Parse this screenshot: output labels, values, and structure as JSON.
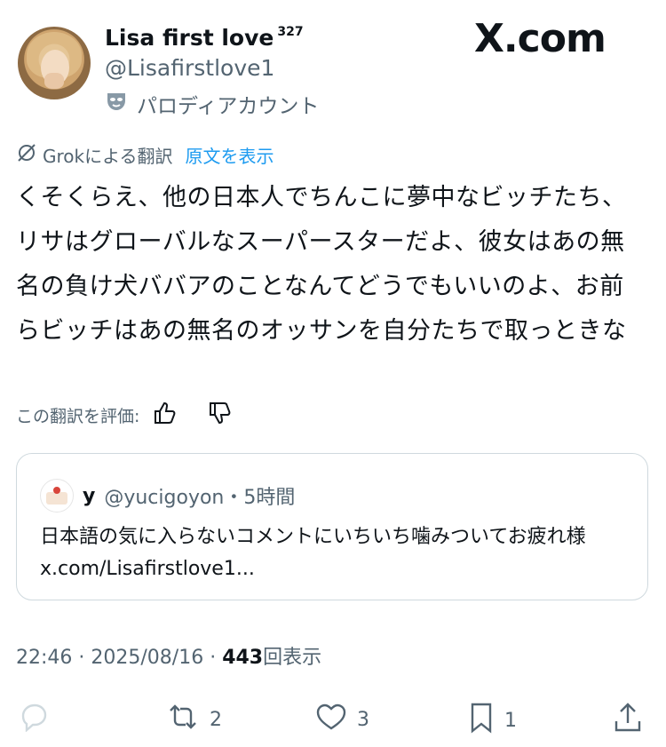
{
  "profile": {
    "display_name": "Lisa first love",
    "name_sup": "327",
    "handle": "@Lisafirstlove1",
    "parody_label": "パロディアカウント"
  },
  "brand": "X.com",
  "translation": {
    "label": "Grokによる翻訳",
    "show_original": "原文を表示",
    "text": "くそくらえ、他の日本人でちんこに夢中なビッチたち、リサはグローバルなスーパースターだよ、彼女はあの無名の負け犬ババアのことなんてどうでもいいのよ、お前らビッチはあの無名のオッサンを自分たちで取っときな",
    "rate_label": "この翻訳を評価:"
  },
  "quote": {
    "name": "y",
    "handle": "@yucigoyon",
    "time": "・5時間",
    "text": "日本語の気に入らないコメントにいちいち噛みついてお疲れ様 x.com/Lisafirstlove1..."
  },
  "meta": {
    "time": "22:46",
    "date": "2025/08/16",
    "views": "443",
    "views_label": "回表示",
    "sep": " · "
  },
  "actions": {
    "reposts": "2",
    "likes": "3",
    "bookmarks": "1"
  },
  "icons": [
    "parody-mask-icon",
    "grok-icon",
    "thumbs-up-icon",
    "thumbs-down-icon",
    "reply-icon",
    "repost-icon",
    "heart-icon",
    "bookmark-icon",
    "share-icon"
  ]
}
